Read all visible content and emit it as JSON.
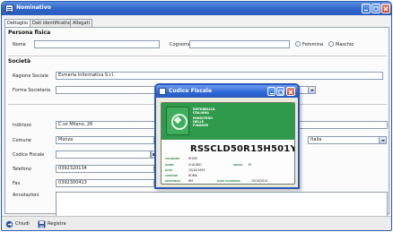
{
  "window": {
    "title": "Nominativo"
  },
  "tabs": [
    {
      "label": "Dettaglio",
      "active": true
    },
    {
      "label": "Dati identificativo",
      "active": false
    },
    {
      "label": "Allegati",
      "active": false
    }
  ],
  "persona_fisica": {
    "section_title": "Persona fisica",
    "nome_label": "Nome",
    "nome_value": "",
    "cognome_label": "Cognome",
    "cognome_value": "",
    "sex_options": [
      "Femmina",
      "Maschio"
    ]
  },
  "societa": {
    "section_title": "Società",
    "ragione_sociale_label": "Ragione Sociale",
    "ragione_sociale_value": "Esmeria Informatica S.r.l.",
    "forma_societaria_label": "Forma Societaria",
    "forma_societaria_value": ""
  },
  "address": {
    "indirizzo_label": "Indirizzo",
    "indirizzo_value": "C.so Milano, 26",
    "comune_label": "Comune",
    "comune_value": "Monza",
    "nazione_value": "Italia",
    "codice_fiscale_label": "Codice Fiscale",
    "codice_fiscale_value": "",
    "telefono_label": "Telefono",
    "telefono_value": "0392320134",
    "fax_label": "Fax",
    "fax_value": "0392300413",
    "annotazioni_label": "Annotazioni",
    "annotazioni_value": ""
  },
  "statusbar": {
    "chiudi_label": "Chiudi",
    "registra_label": "Registra"
  },
  "dialog": {
    "title": "Codice Fiscale",
    "card": {
      "header_lines": [
        "REPUBBLICA",
        "ITALIANA",
        "MINISTERO",
        "DELLE",
        "FINANZE"
      ],
      "code": "RSSCLD50R15H501Y",
      "field_labels": [
        "COGNOME",
        "NOME",
        "DATA",
        "COMUNE",
        "PROVINCIA"
      ],
      "field_values": [
        "ROSSI",
        "CLAUDIO",
        "15/10/1950",
        "ROMA",
        "RM"
      ],
      "sesso_label": "SESSO",
      "sesso_value": "M",
      "scadenza_label": "DATA SCADENZA",
      "scadenza_value": "15/10/2014"
    }
  },
  "colors": {
    "titlebar": "#2d64c8",
    "card_green": "#2f9a4c",
    "close_red": "#c43d1c"
  }
}
